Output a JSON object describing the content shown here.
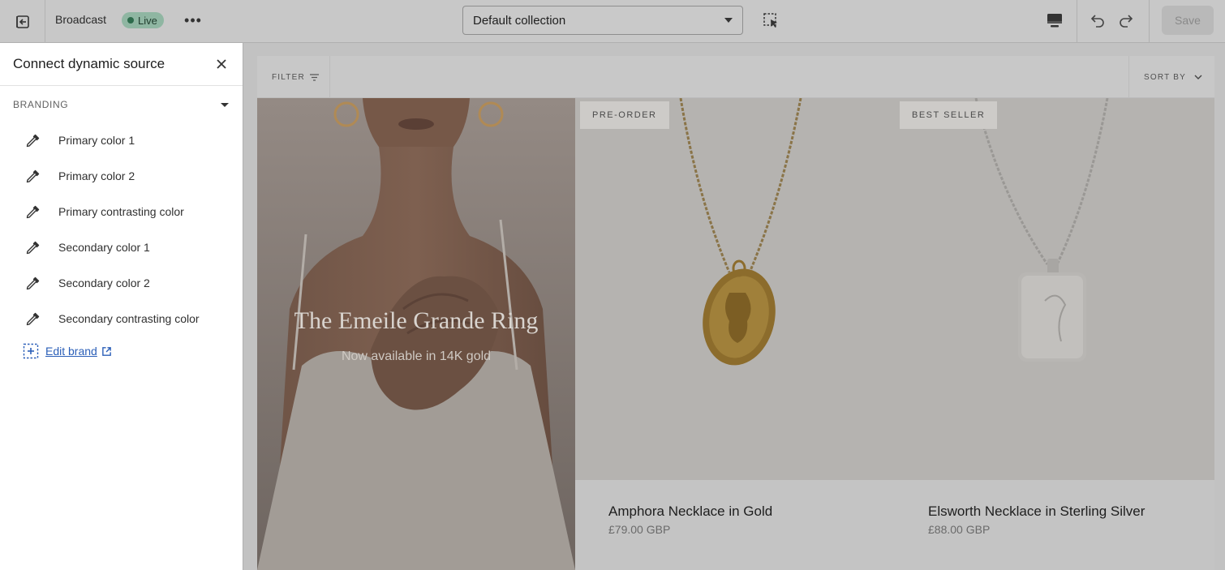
{
  "topbar": {
    "theme_name": "Broadcast",
    "status": "Live",
    "more": "•••",
    "template_select": "Default collection",
    "save_label": "Save",
    "status_color": "#2e6b4c"
  },
  "panel": {
    "title": "Connect dynamic source",
    "group": "BRANDING",
    "items": [
      {
        "label": "Primary color 1"
      },
      {
        "label": "Primary color 2"
      },
      {
        "label": "Primary contrasting color"
      },
      {
        "label": "Secondary color 1"
      },
      {
        "label": "Secondary color 2"
      },
      {
        "label": "Secondary contrasting color"
      }
    ],
    "edit_brand": "Edit brand",
    "link_color": "#2b5fb8"
  },
  "preview": {
    "filter_label": "FILTER",
    "sort_label": "SORT BY",
    "hero": {
      "title": "The Emeile Grande Ring",
      "subtitle": "Now available in 14K gold"
    },
    "products": [
      {
        "badge": "PRE-ORDER",
        "name": "Amphora Necklace in Gold",
        "price": "£79.00 GBP"
      },
      {
        "badge": "BEST SELLER",
        "name": "Elsworth Necklace in Sterling Silver",
        "price": "£88.00 GBP"
      }
    ]
  }
}
